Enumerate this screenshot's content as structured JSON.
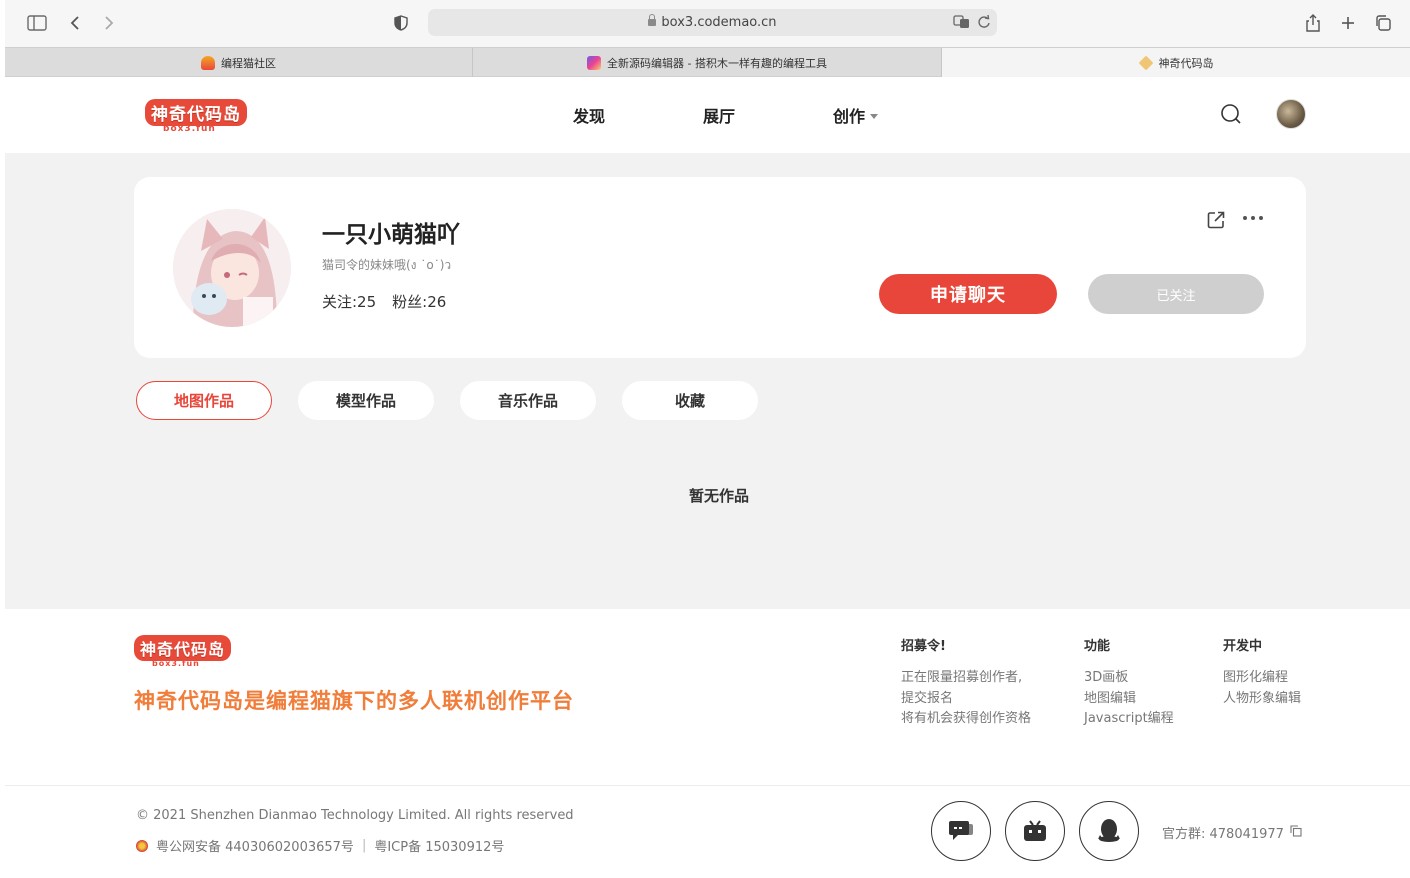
{
  "browser": {
    "url": "box3.codemao.cn",
    "tabs": [
      {
        "label": "编程猫社区"
      },
      {
        "label": "全新源码编辑器 - 搭积木一样有趣的编程工具"
      },
      {
        "label": "神奇代码岛"
      }
    ]
  },
  "site": {
    "logo_main": "神奇代码岛",
    "logo_sub": "box3.fun",
    "nav": [
      {
        "label": "发现"
      },
      {
        "label": "展厅"
      },
      {
        "label": "创作"
      }
    ]
  },
  "profile": {
    "name": "一只小萌猫吖",
    "signature": "猫司令的妹妹哦(ง ˙o˙)ว",
    "following": "关注:25",
    "followers": "粉丝:26",
    "chat_button": "申请聊天",
    "follow_button": "已关注"
  },
  "work_tabs": [
    {
      "label": "地图作品"
    },
    {
      "label": "模型作品"
    },
    {
      "label": "音乐作品"
    },
    {
      "label": "收藏"
    }
  ],
  "empty_text": "暂无作品",
  "footer": {
    "slogan": "神奇代码岛是编程猫旗下的多人联机创作平台",
    "columns": [
      {
        "title": "招募令!",
        "lines": [
          "正在限量招募创作者,",
          "提交报名",
          "将有机会获得创作资格"
        ]
      },
      {
        "title": "功能",
        "lines": [
          "3D画板",
          "地图编辑",
          "Javascript编程"
        ]
      },
      {
        "title": "开发中",
        "lines": [
          "图形化编程",
          "人物形象编辑"
        ]
      }
    ],
    "copyright": "© 2021 Shenzhen Dianmao Technology Limited. All rights reserved",
    "police_record": "粤公网安备 44030602003657号",
    "icp_separator": "|",
    "icp": "粤ICP备 15030912号",
    "qq_group": "官方群: 478041977"
  },
  "colors": {
    "brand_red": "#e8463a",
    "slogan_orange": "#f07d3a"
  }
}
